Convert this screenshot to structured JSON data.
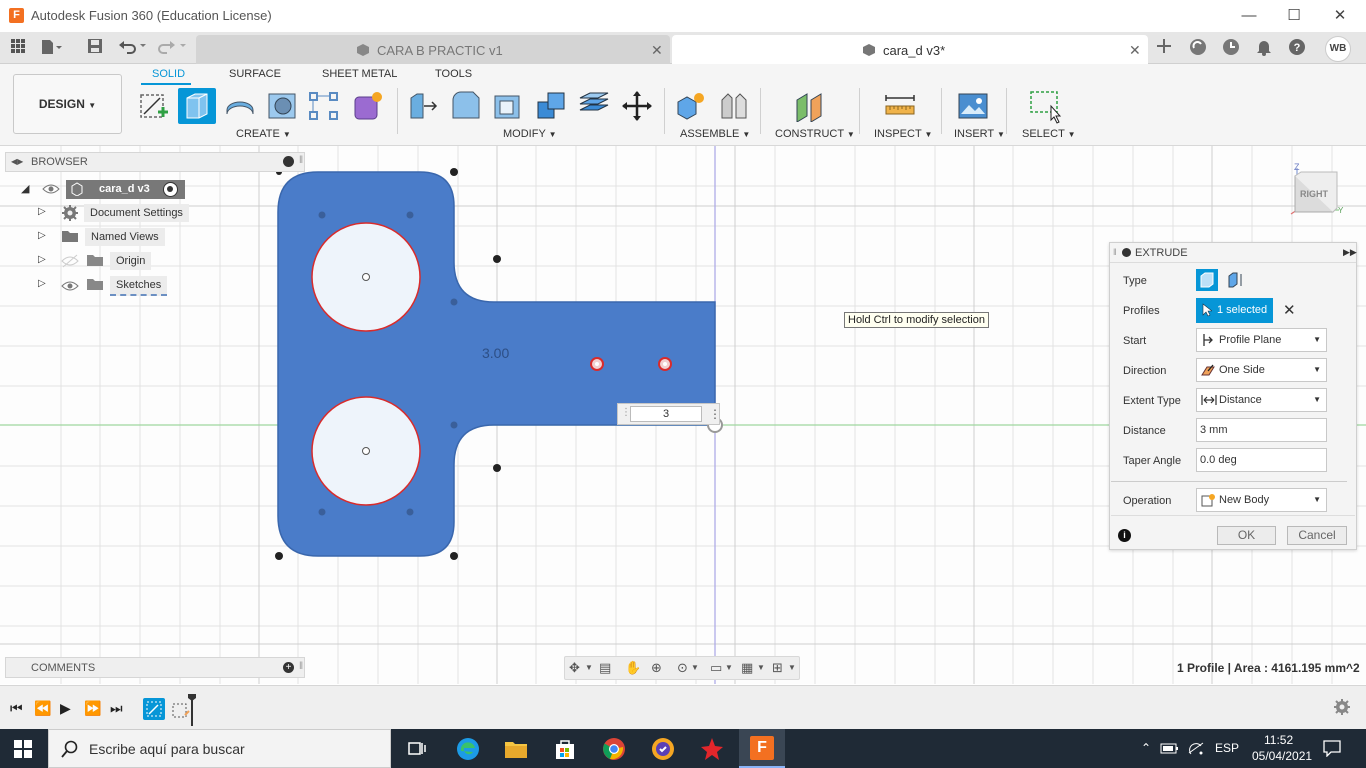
{
  "window": {
    "title": "Autodesk Fusion 360 (Education License)",
    "minimize": "—",
    "maximize": "☐",
    "close": "✕"
  },
  "tabs": [
    {
      "label": "CARA B PRACTIC v1",
      "active": false
    },
    {
      "label": "cara_d v3*",
      "active": true
    }
  ],
  "user": {
    "initials": "WB"
  },
  "toolbar": {
    "design_label": "DESIGN",
    "workspace_tabs": [
      "SOLID",
      "SURFACE",
      "SHEET METAL",
      "TOOLS"
    ],
    "groups": [
      "CREATE",
      "MODIFY",
      "ASSEMBLE",
      "CONSTRUCT",
      "INSPECT",
      "INSERT",
      "SELECT"
    ]
  },
  "browser": {
    "title": "BROWSER",
    "root": "cara_d v3",
    "items": [
      "Document Settings",
      "Named Views",
      "Origin",
      "Sketches"
    ]
  },
  "viewport": {
    "dimension_label": "3.00",
    "distance_input": "3",
    "tooltip": "Hold Ctrl to modify selection",
    "viewcube_face": "RIGHT",
    "axis_z": "Z",
    "axis_y": "Y"
  },
  "extrude": {
    "title": "EXTRUDE",
    "labels": {
      "type": "Type",
      "profiles": "Profiles",
      "start": "Start",
      "direction": "Direction",
      "extent_type": "Extent Type",
      "distance": "Distance",
      "taper": "Taper Angle",
      "operation": "Operation"
    },
    "values": {
      "profiles": "1 selected",
      "start": "Profile Plane",
      "direction": "One Side",
      "extent_type": "Distance",
      "distance": "3 mm",
      "taper": "0.0 deg",
      "operation": "New Body"
    },
    "ok": "OK",
    "cancel": "Cancel"
  },
  "comments": {
    "title": "COMMENTS"
  },
  "status": {
    "text": "1 Profile | Area : 4161.195 mm^2"
  },
  "taskbar": {
    "search_placeholder": "Escribe aquí para buscar",
    "language": "ESP",
    "time": "11:52",
    "date": "05/04/2021"
  },
  "colors": {
    "accent": "#0696d7",
    "body_fill": "#4a7cc9",
    "profile_edge": "#d92b2b"
  }
}
